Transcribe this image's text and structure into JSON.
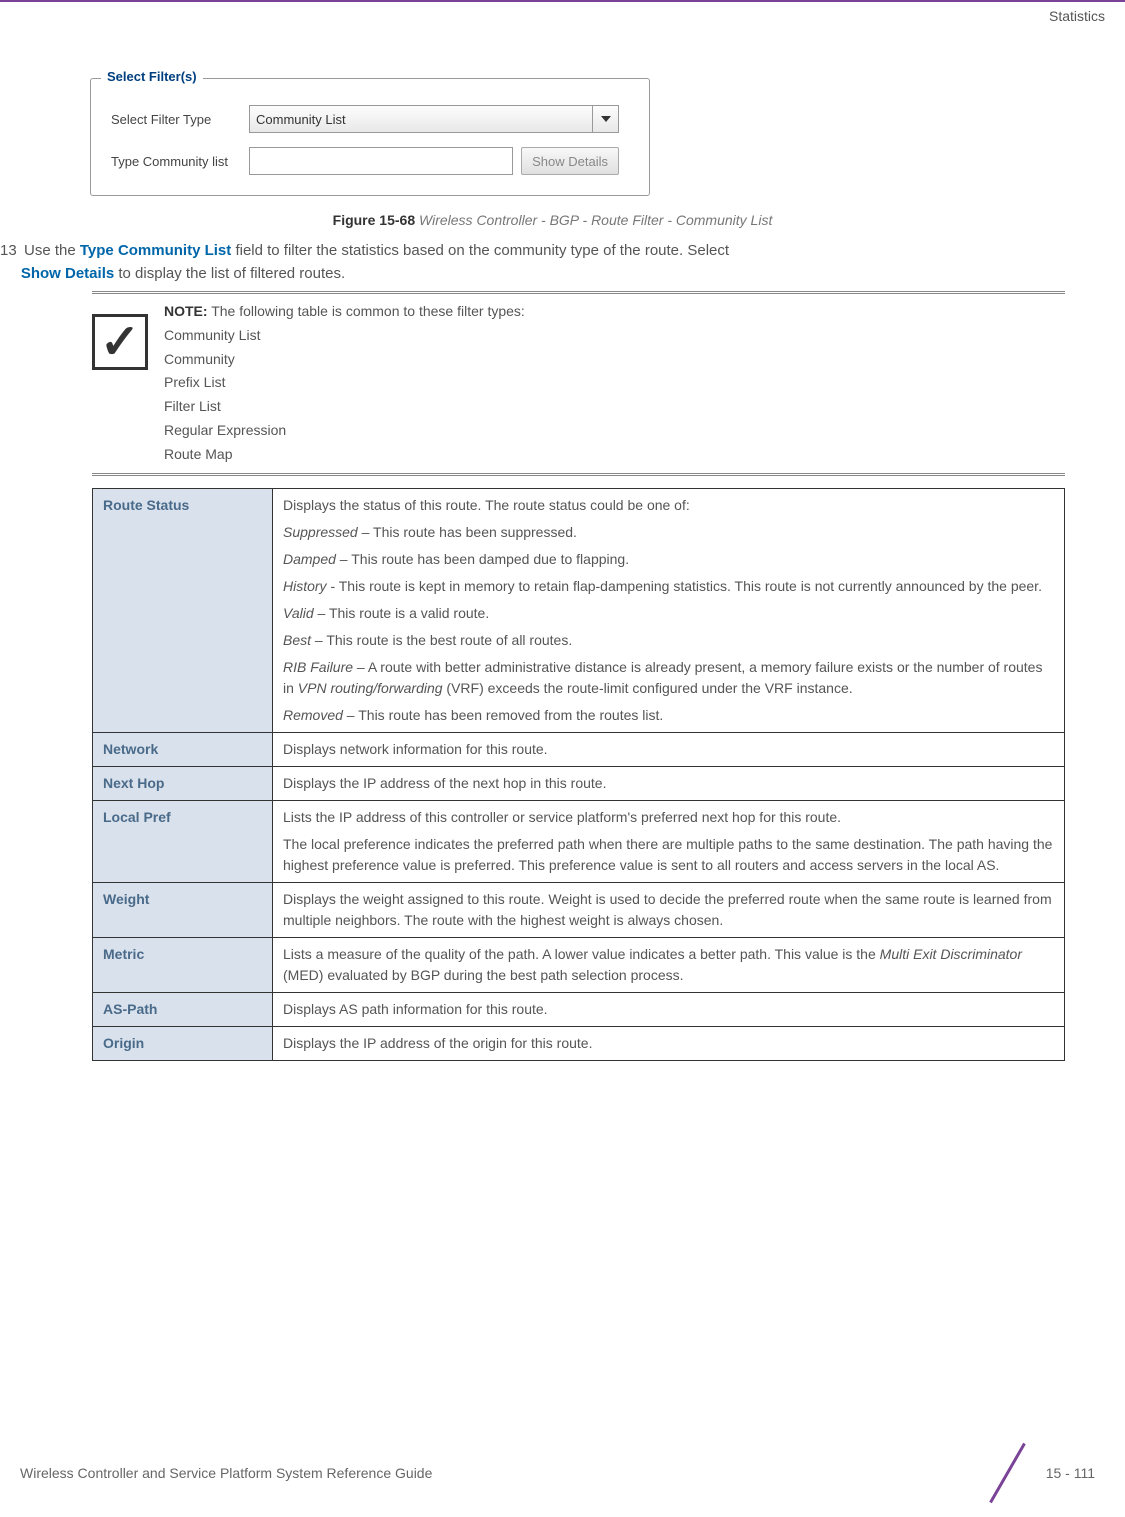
{
  "header": {
    "section_title": "Statistics"
  },
  "filter_box": {
    "legend": "Select Filter(s)",
    "row1_label": "Select Filter Type",
    "row1_value": "Community List",
    "row2_label": "Type Community list",
    "row2_value": "",
    "show_details": "Show Details"
  },
  "figure": {
    "label": "Figure 15-68",
    "caption": "Wireless Controller - BGP - Route Filter - Community List"
  },
  "step": {
    "number": "13",
    "pre": "Use the ",
    "em1": "Type Community List",
    "mid": " field to filter the statistics based on the community type of the route. Select ",
    "em2": "Show Details",
    "post": " to display the list of filtered routes."
  },
  "note": {
    "title": "NOTE:",
    "intro": " The following table is common to these filter types:",
    "items": [
      "Community List",
      "Community",
      "Prefix List",
      "Filter List",
      "Regular Expression",
      "Route Map"
    ]
  },
  "table": {
    "rows": [
      {
        "term": "Route Status",
        "lines": [
          {
            "plain": "Displays the status of this route. The route status could be one of:"
          },
          {
            "italic": "Suppressed",
            "rest": " – This route has been suppressed."
          },
          {
            "italic": "Damped",
            "rest": " – This route has been damped due to flapping."
          },
          {
            "italic": "History",
            "rest": " - This route is kept in memory to retain flap-dampening statistics. This route is not currently announced by the peer."
          },
          {
            "italic": "Valid",
            "rest": " – This route is a valid route."
          },
          {
            "italic": "Best",
            "rest": " – This route is the best route of all routes."
          },
          {
            "italic": "RIB Failure",
            "rest": " – A route with better administrative distance is already present, a memory failure exists or the number of routes in ",
            "italic2": "VPN routing/forwarding",
            "rest2": " (VRF) exceeds the route-limit configured under the VRF instance."
          },
          {
            "italic": "Removed",
            "rest": " – This route has been removed from the routes list."
          }
        ]
      },
      {
        "term": "Network",
        "lines": [
          {
            "plain": "Displays network information for this route."
          }
        ]
      },
      {
        "term": "Next Hop",
        "lines": [
          {
            "plain": "Displays the IP address of the next hop in this route."
          }
        ]
      },
      {
        "term": "Local Pref",
        "lines": [
          {
            "plain": "Lists the IP address of this controller or service platform's preferred next hop for this route."
          },
          {
            "plain": "The local preference indicates the preferred path when there are multiple paths to the same destination. The path having the highest preference value is preferred. This preference value is sent to all routers and access servers in the local AS."
          }
        ]
      },
      {
        "term": "Weight",
        "lines": [
          {
            "plain": "Displays the weight assigned to this route. Weight is used to decide the preferred route when the same route is learned from multiple neighbors. The route with the highest weight is always chosen."
          }
        ]
      },
      {
        "term": "Metric",
        "lines": [
          {
            "plain_pre": "Lists a measure of the quality of the path. A lower value indicates a better path. This value is the ",
            "italic": "Multi Exit Discriminator",
            "plain_post": " (MED) evaluated by BGP during the best path selection process."
          }
        ]
      },
      {
        "term": "AS-Path",
        "lines": [
          {
            "plain": "Displays AS path information for this route."
          }
        ]
      },
      {
        "term": "Origin",
        "lines": [
          {
            "plain": "Displays the IP address of the origin for this route."
          }
        ]
      }
    ]
  },
  "footer": {
    "left": "Wireless Controller and Service Platform System Reference Guide",
    "right": "15 - 111"
  }
}
